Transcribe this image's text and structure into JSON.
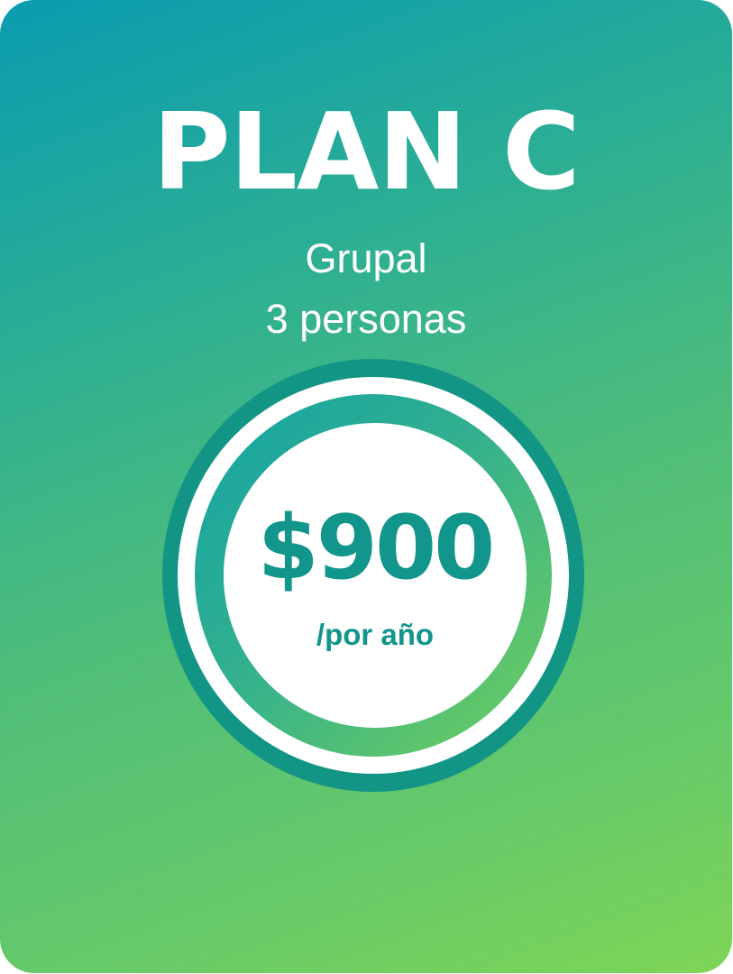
{
  "plan": {
    "title": "PLAN C",
    "type": "Grupal",
    "people": "3 personas"
  },
  "pricing": {
    "price": "$900",
    "period": "/por año"
  },
  "colors": {
    "gradient_start": "#0a9bb0",
    "gradient_end": "#7ed556",
    "accent": "#12958a",
    "text_light": "#ffffff"
  }
}
